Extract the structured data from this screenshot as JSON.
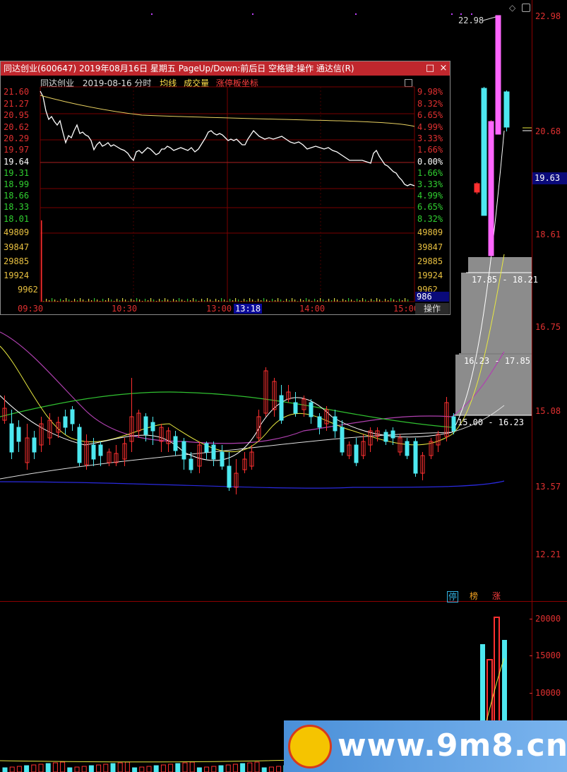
{
  "main_chart": {
    "price_axis_labels": [
      "22.98",
      "20.68",
      "18.61",
      "16.75",
      "15.08",
      "13.57",
      "12.21"
    ],
    "current_price": "19.63",
    "peak_label": "22.98",
    "ranges": [
      "17.85 - 18.21",
      "16.23 - 17.85",
      "15.00 - 16.23"
    ],
    "tags": [
      {
        "text": "停",
        "color": "#33b5e5"
      },
      {
        "text": "榜",
        "color": "#f0a020"
      },
      {
        "text": "涨",
        "color": "#ff4040"
      }
    ]
  },
  "volume_chart": {
    "axis_labels": [
      "20000",
      "15000",
      "10000"
    ]
  },
  "popup": {
    "title": "同达创业(600647) 2019年08月16日 星期五 PageUp/Down:前后日 空格键:操作 通达信(R)",
    "restore_icon": "□",
    "close_icon": "×",
    "stock_name": "同达创业",
    "date_mode": "2019-08-16 分时",
    "avg_line_label": "均线",
    "volume_label": "成交量",
    "limit_coord_label": "涨停板坐标",
    "left_prices": [
      {
        "v": "21.60",
        "c": "#e03030"
      },
      {
        "v": "21.27",
        "c": "#e03030"
      },
      {
        "v": "20.95",
        "c": "#e03030"
      },
      {
        "v": "20.62",
        "c": "#e03030"
      },
      {
        "v": "20.29",
        "c": "#e03030"
      },
      {
        "v": "19.97",
        "c": "#e03030"
      },
      {
        "v": "19.64",
        "c": "#ffffff"
      },
      {
        "v": "19.31",
        "c": "#30d030"
      },
      {
        "v": "18.99",
        "c": "#30d030"
      },
      {
        "v": "18.66",
        "c": "#30d030"
      },
      {
        "v": "18.33",
        "c": "#30d030"
      },
      {
        "v": "18.01",
        "c": "#30d030"
      }
    ],
    "right_pcts": [
      {
        "v": "9.98%",
        "c": "#e03030"
      },
      {
        "v": "8.32%",
        "c": "#e03030"
      },
      {
        "v": "6.65%",
        "c": "#e03030"
      },
      {
        "v": "4.99%",
        "c": "#e03030"
      },
      {
        "v": "3.33%",
        "c": "#e03030"
      },
      {
        "v": "1.66%",
        "c": "#e03030"
      },
      {
        "v": "0.00%",
        "c": "#ffffff"
      },
      {
        "v": "1.66%",
        "c": "#30d030"
      },
      {
        "v": "3.33%",
        "c": "#30d030"
      },
      {
        "v": "4.99%",
        "c": "#30d030"
      },
      {
        "v": "6.65%",
        "c": "#30d030"
      },
      {
        "v": "8.32%",
        "c": "#30d030"
      }
    ],
    "vol_left": [
      "49809",
      "39847",
      "29885",
      "19924",
      "9962"
    ],
    "vol_right": [
      "49809",
      "39847",
      "29885",
      "19924",
      "9962"
    ],
    "vol_current": "986",
    "times": [
      "09:30",
      "10:30",
      "13:00",
      "13:18",
      "14:00",
      "15:00"
    ],
    "operate_button": "操作"
  },
  "watermark": {
    "text": "www.9m8.cn"
  }
}
